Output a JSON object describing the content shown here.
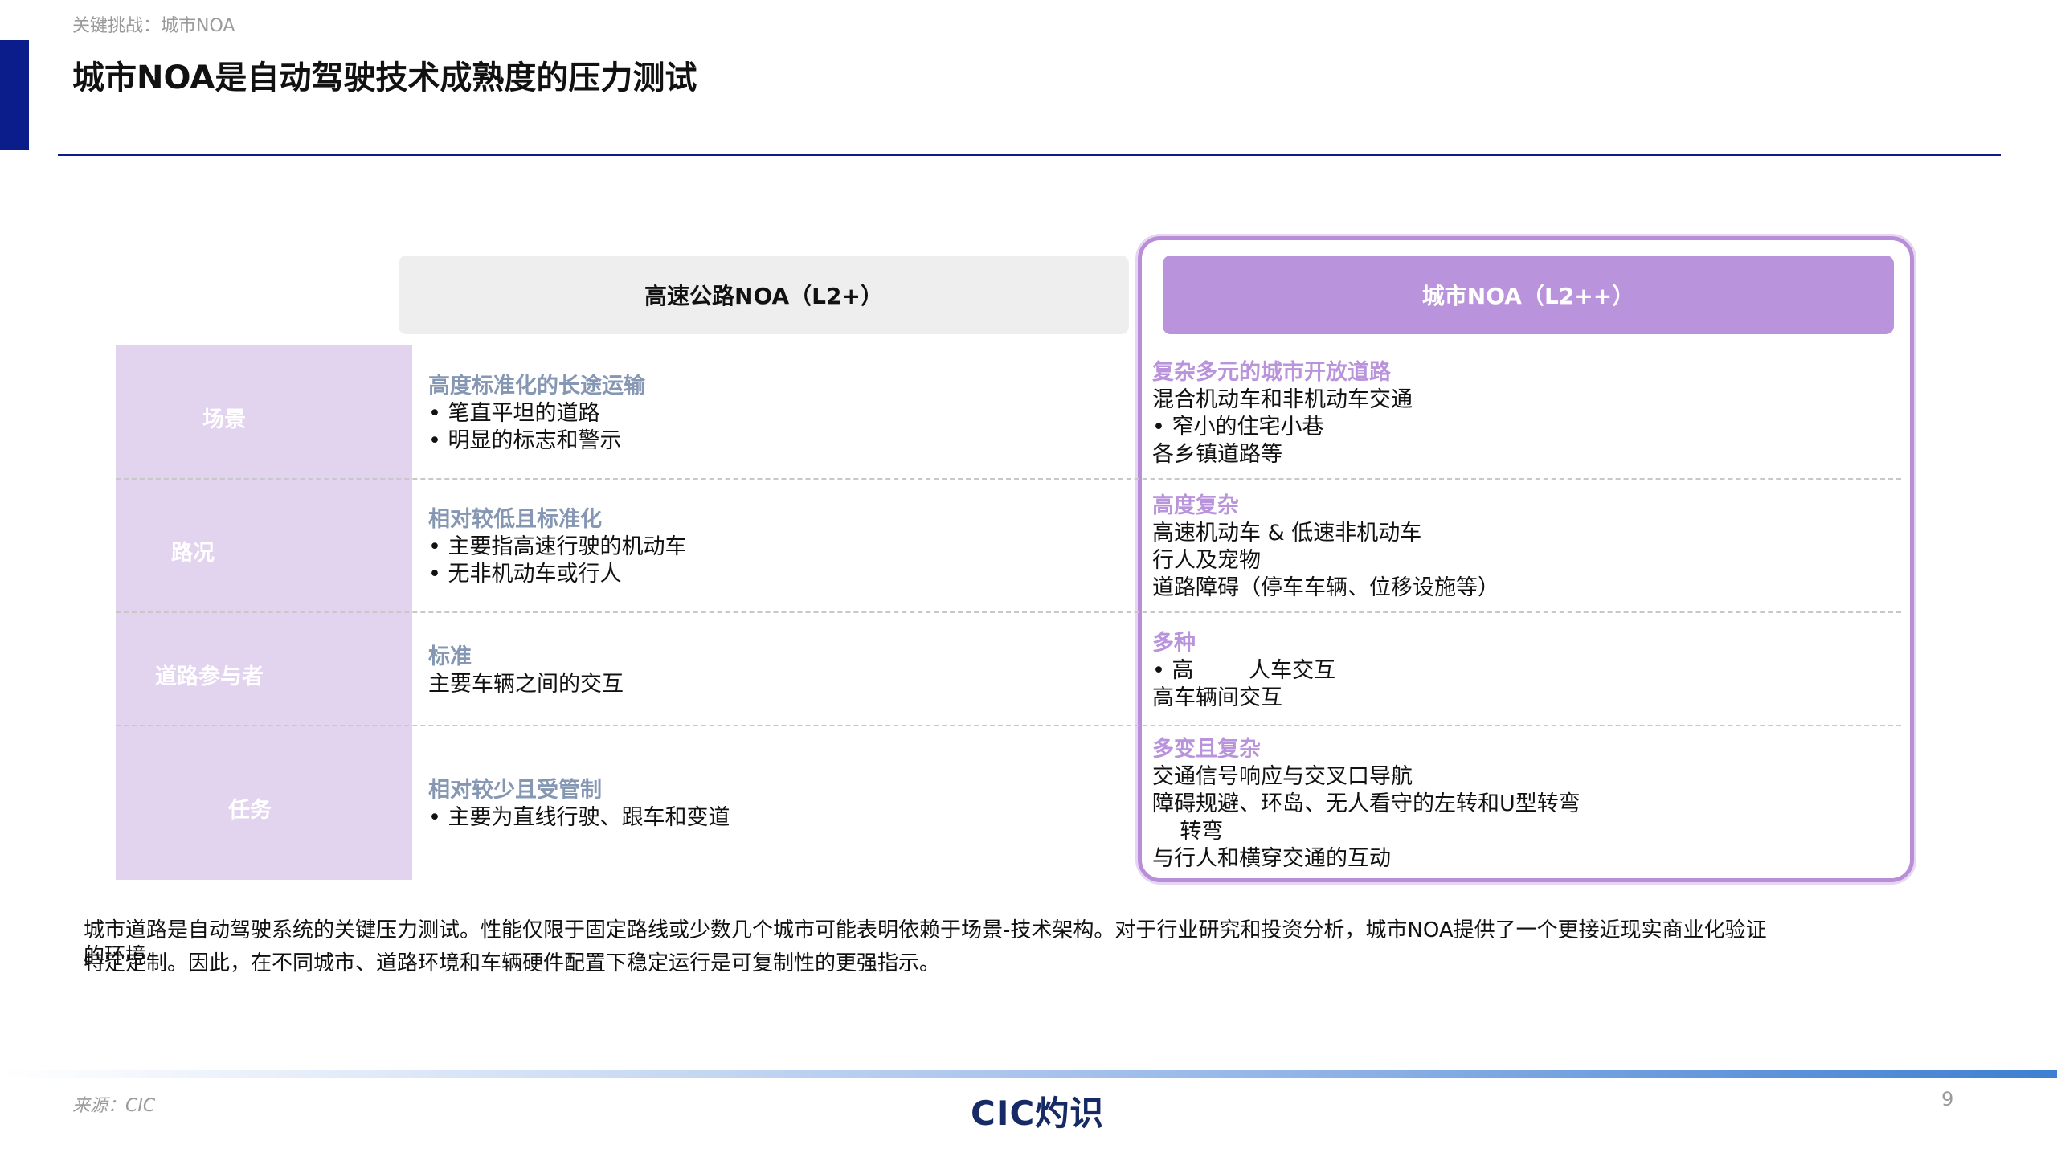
{
  "header": {
    "breadcrumb": "关键挑战：城市NOA",
    "title": "城市NOA是自动驾驶技术成熟度的压力测试"
  },
  "columns": {
    "highway": "高速公路NOA（L2+）",
    "city": "城市NOA（L2++）"
  },
  "row_labels": [
    "场景",
    "路况",
    "道路参与者",
    "任务"
  ],
  "highway_cells": [
    {
      "head": "高度标准化的长途运输",
      "lines": [
        "• 笔直平坦的道路",
        "• 明显的标志和警示"
      ]
    },
    {
      "head": "相对较低且标准化",
      "lines": [
        "• 主要指高速行驶的机动车",
        "• 无非机动车或行人"
      ]
    },
    {
      "head": "标准",
      "lines": [
        "主要车辆之间的交互"
      ]
    },
    {
      "head": "相对较少且受管制",
      "lines": [
        "• 主要为直线行驶、跟车和变道"
      ]
    }
  ],
  "city_cells": [
    {
      "head": "复杂多元的城市开放道路",
      "lines": [
        "混合机动车和非机动车交通",
        "• 窄小的住宅小巷",
        "各乡镇道路等"
      ]
    },
    {
      "head": "高度复杂",
      "lines": [
        "高速机动车 & 低速非机动车",
        "行人及宠物",
        "道路障碍（停车车辆、位移设施等）"
      ]
    },
    {
      "head": "多种",
      "lines": [
        "• 高        人车交互",
        "高车辆间交互"
      ]
    },
    {
      "head": "多变且复杂",
      "lines": [
        "交通信号响应与交叉口导航",
        "障碍规避、环岛、无人看守的左转和U型转弯",
        "    转弯",
        "与行人和横穿交通的互动"
      ]
    }
  ],
  "summary": {
    "line1": "城市道路是自动驾驶系统的关键压力测试。性能仅限于固定路线或少数几个城市可能表明依赖于场景-技术架构。对于行业研究和投资分析，城市NOA提供了一个更接近现实商业化验证",
    "line1_overlap": "的环境",
    "line2": "特定定制。因此，在不同城市、道路环境和车辆硬件配置下稳定运行是可复制性的更强指示。"
  },
  "footer": {
    "source": "来源：CIC",
    "logo": "CIC灼识",
    "page": "9"
  },
  "colors": {
    "navy": "#0b1d8a",
    "purple": "#b993db",
    "lavender": "#e2d3ee",
    "grey_head": "#8597b3"
  }
}
